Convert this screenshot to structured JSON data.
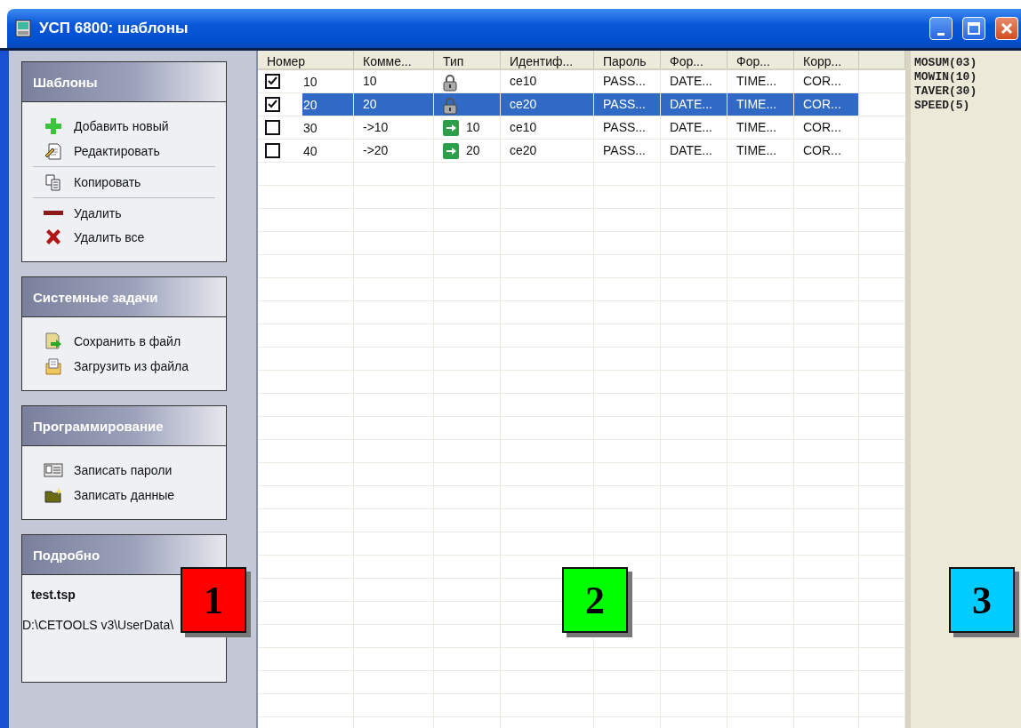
{
  "window": {
    "title": "УСП 6800: шаблоны"
  },
  "sidebar": {
    "panels": [
      {
        "title": "Шаблоны",
        "groups": [
          [
            {
              "kind": "add",
              "label": "Добавить новый"
            },
            {
              "kind": "edit",
              "label": "Редактировать"
            }
          ],
          [
            {
              "kind": "copy",
              "label": "Копировать"
            }
          ],
          [
            {
              "kind": "remove",
              "label": "Удалить"
            },
            {
              "kind": "remove-all",
              "label": "Удалить все"
            }
          ]
        ]
      },
      {
        "title": "Системные задачи",
        "groups": [
          [
            {
              "kind": "save",
              "label": "Сохранить в файл"
            },
            {
              "kind": "load",
              "label": "Загрузить из файла"
            }
          ]
        ]
      },
      {
        "title": "Программирование",
        "groups": [
          [
            {
              "kind": "passwords",
              "label": "Записать пароли"
            },
            {
              "kind": "data",
              "label": "Записать данные"
            }
          ]
        ]
      }
    ],
    "details": {
      "title": "Подробно",
      "filename": "test.tsp",
      "path": "D:\\CETOOLS v3\\UserData\\"
    }
  },
  "table": {
    "columns": [
      "Номер",
      "Комме...",
      "Тип",
      "Идентиф...",
      "Пароль",
      "Фор...",
      "Фор...",
      "Корр..."
    ],
    "rows": [
      {
        "checked": true,
        "selected": false,
        "number": "10",
        "comment": "10",
        "type": {
          "kind": "lock"
        },
        "id": "ce10",
        "password": "PASS...",
        "date_format": "DATE...",
        "time_format": "TIME...",
        "correction": "COR..."
      },
      {
        "checked": true,
        "selected": true,
        "number": "20",
        "comment": "20",
        "type": {
          "kind": "lock"
        },
        "id": "ce20",
        "password": "PASS...",
        "date_format": "DATE...",
        "time_format": "TIME...",
        "correction": "COR..."
      },
      {
        "checked": false,
        "selected": false,
        "number": "30",
        "comment": "->10",
        "type": {
          "kind": "link",
          "label": "10"
        },
        "id": "ce10",
        "password": "PASS...",
        "date_format": "DATE...",
        "time_format": "TIME...",
        "correction": "COR..."
      },
      {
        "checked": false,
        "selected": false,
        "number": "40",
        "comment": "->20",
        "type": {
          "kind": "link",
          "label": "20"
        },
        "id": "ce20",
        "password": "PASS...",
        "date_format": "DATE...",
        "time_format": "TIME...",
        "correction": "COR..."
      }
    ]
  },
  "side_list": {
    "items": [
      "MOSUM(03)",
      "MOWIN(10)",
      "TAVER(30)",
      "SPEED(5)"
    ]
  },
  "callouts": [
    {
      "label": "1",
      "color": "#ff0000"
    },
    {
      "label": "2",
      "color": "#00ff00"
    },
    {
      "label": "3",
      "color": "#00ccff"
    }
  ]
}
